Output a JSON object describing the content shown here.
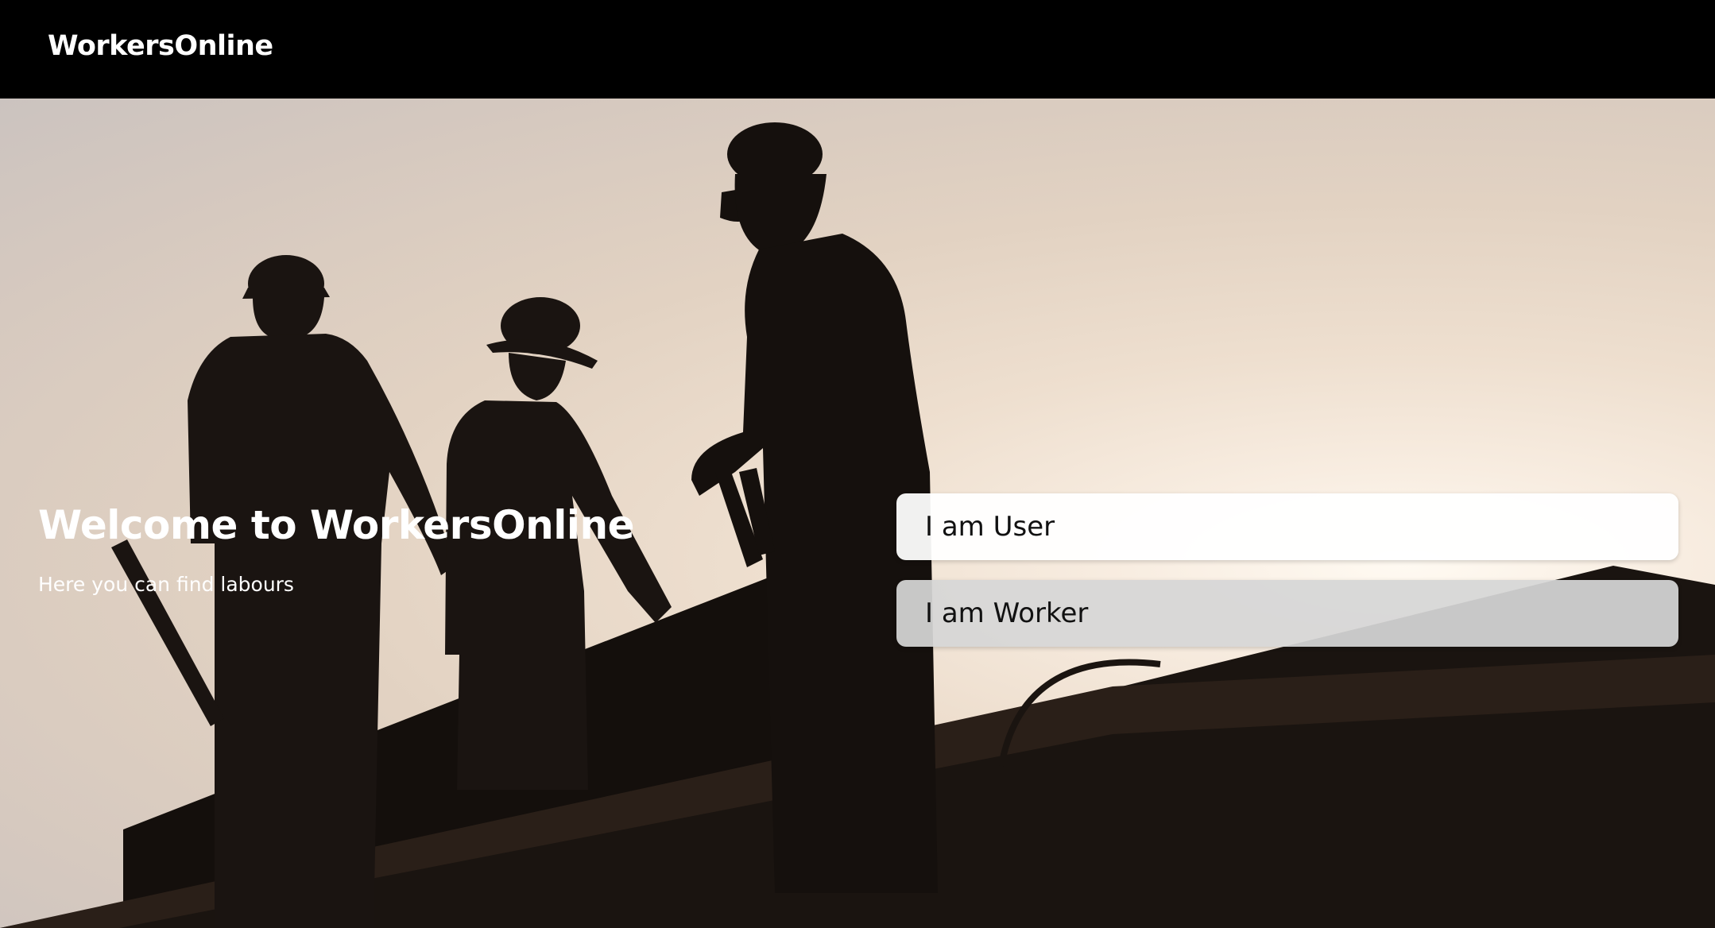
{
  "navbar": {
    "brand": "WorkersOnline"
  },
  "hero": {
    "title": "Welcome to WorkersOnline",
    "subtitle": "Here you can find labours",
    "buttons": {
      "user_label": "I am User",
      "worker_label": "I am Worker"
    }
  }
}
